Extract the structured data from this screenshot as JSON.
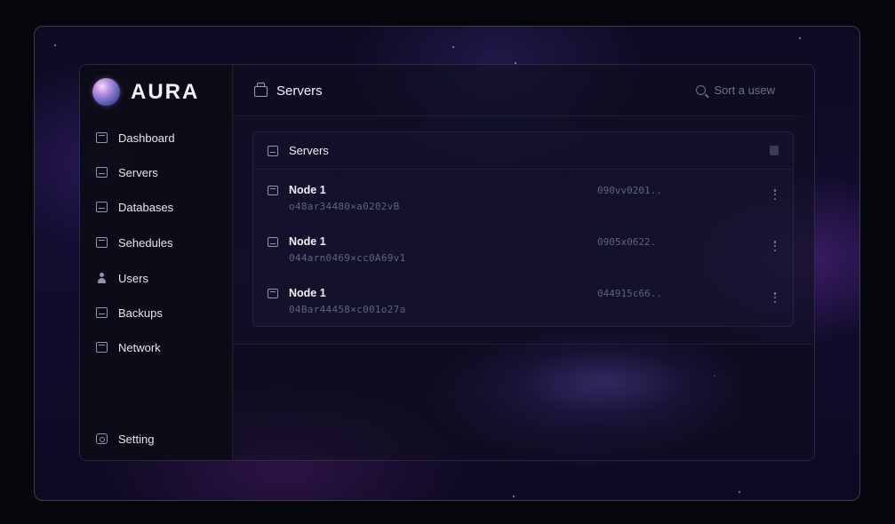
{
  "brand": {
    "name": "AURA"
  },
  "sidebar": {
    "items": [
      {
        "label": "Dashboard",
        "icon": "dashboard-icon"
      },
      {
        "label": "Servers",
        "icon": "server-icon"
      },
      {
        "label": "Databases",
        "icon": "database-icon"
      },
      {
        "label": "Sehedules",
        "icon": "calendar-icon"
      },
      {
        "label": "Users",
        "icon": "user-icon"
      },
      {
        "label": "Backups",
        "icon": "backup-icon"
      },
      {
        "label": "Network",
        "icon": "network-icon"
      }
    ],
    "footer": {
      "label": "Setting",
      "icon": "gear-icon"
    }
  },
  "header": {
    "title": "Servers",
    "search_placeholder": "Sort a usew"
  },
  "panel": {
    "title": "Servers",
    "rows": [
      {
        "name": "Node 1",
        "hash": "o48ar34480×a0202vB",
        "code": "090vv0201.."
      },
      {
        "name": "Node 1",
        "hash": "044arn0469×cc0A69v1",
        "code": "0905x0622."
      },
      {
        "name": "Node 1",
        "hash": "04Bar44458×c001o27a",
        "code": "044915c66.."
      }
    ]
  },
  "colors": {
    "background": "#04060b",
    "sidebar": "#0b0b16",
    "text": "#e4e6f0",
    "muted": "#5f6380",
    "accent": "#8c6eff"
  }
}
